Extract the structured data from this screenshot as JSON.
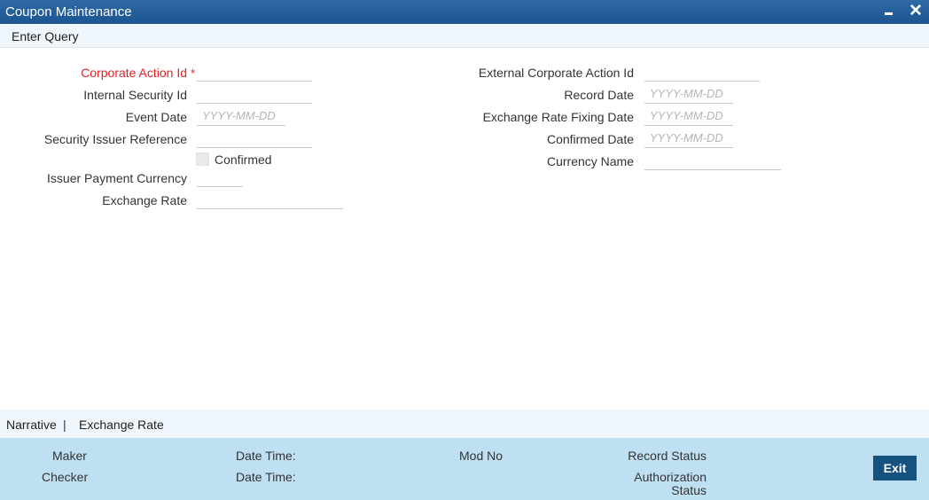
{
  "window": {
    "title": "Coupon Maintenance"
  },
  "toolbar": {
    "enter_query": "Enter Query"
  },
  "form": {
    "corporate_action_id": {
      "label": "Corporate Action Id",
      "required_marker": "*",
      "value": ""
    },
    "internal_security_id": {
      "label": "Internal Security Id",
      "value": ""
    },
    "event_date": {
      "label": "Event Date",
      "placeholder": "YYYY-MM-DD"
    },
    "security_issuer_reference": {
      "label": "Security Issuer Reference",
      "value": ""
    },
    "confirmed": {
      "label": "Confirmed",
      "checked": false
    },
    "issuer_payment_currency": {
      "label": "Issuer Payment Currency",
      "value": ""
    },
    "exchange_rate": {
      "label": "Exchange Rate",
      "value": ""
    },
    "external_corporate_action_id": {
      "label": "External Corporate Action Id",
      "value": ""
    },
    "record_date": {
      "label": "Record Date",
      "placeholder": "YYYY-MM-DD"
    },
    "exchange_rate_fixing_date": {
      "label": "Exchange Rate Fixing Date",
      "placeholder": "YYYY-MM-DD"
    },
    "confirmed_date": {
      "label": "Confirmed Date",
      "placeholder": "YYYY-MM-DD"
    },
    "currency_name": {
      "label": "Currency Name",
      "value": ""
    }
  },
  "subtabs": {
    "narrative": "Narrative",
    "separator": "|",
    "exchange_rate": "Exchange Rate"
  },
  "footer": {
    "maker": "Maker",
    "checker": "Checker",
    "date_time_1": "Date Time:",
    "date_time_2": "Date Time:",
    "mod_no": "Mod No",
    "record_status": "Record Status",
    "authorization_status_line1": "Authorization",
    "authorization_status_line2": "Status",
    "exit": "Exit"
  },
  "colors": {
    "titlebar": "#1c5590",
    "required_label": "#e02020",
    "footer_bg": "#bfe0f2",
    "exit_button": "#15527f"
  }
}
